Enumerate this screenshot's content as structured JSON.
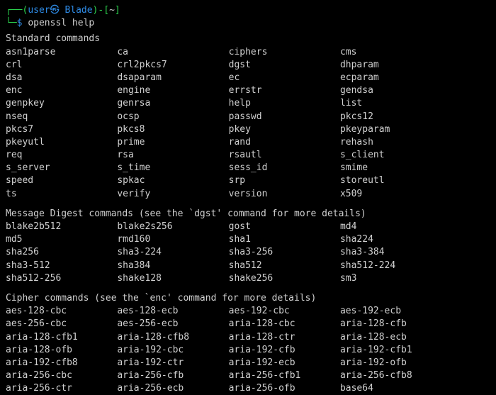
{
  "prompt": {
    "open_paren": "┌──(",
    "user": "user㉿ Blade",
    "close_paren": ")-[",
    "cwd": "~",
    "close_bracket": "]",
    "line2_prefix": "└─",
    "dollar": "$",
    "command": "openssl help"
  },
  "sections": {
    "standard": {
      "heading": "Standard commands",
      "rows": [
        [
          "asn1parse",
          "ca",
          "ciphers",
          "cms"
        ],
        [
          "crl",
          "crl2pkcs7",
          "dgst",
          "dhparam"
        ],
        [
          "dsa",
          "dsaparam",
          "ec",
          "ecparam"
        ],
        [
          "enc",
          "engine",
          "errstr",
          "gendsa"
        ],
        [
          "genpkey",
          "genrsa",
          "help",
          "list"
        ],
        [
          "nseq",
          "ocsp",
          "passwd",
          "pkcs12"
        ],
        [
          "pkcs7",
          "pkcs8",
          "pkey",
          "pkeyparam"
        ],
        [
          "pkeyutl",
          "prime",
          "rand",
          "rehash"
        ],
        [
          "req",
          "rsa",
          "rsautl",
          "s_client"
        ],
        [
          "s_server",
          "s_time",
          "sess_id",
          "smime"
        ],
        [
          "speed",
          "spkac",
          "srp",
          "storeutl"
        ],
        [
          "ts",
          "verify",
          "version",
          "x509"
        ]
      ]
    },
    "digest": {
      "heading": "Message Digest commands (see the `dgst' command for more details)",
      "rows": [
        [
          "blake2b512",
          "blake2s256",
          "gost",
          "md4"
        ],
        [
          "md5",
          "rmd160",
          "sha1",
          "sha224"
        ],
        [
          "sha256",
          "sha3-224",
          "sha3-256",
          "sha3-384"
        ],
        [
          "sha3-512",
          "sha384",
          "sha512",
          "sha512-224"
        ],
        [
          "sha512-256",
          "shake128",
          "shake256",
          "sm3"
        ]
      ]
    },
    "cipher": {
      "heading": "Cipher commands (see the `enc' command for more details)",
      "rows": [
        [
          "aes-128-cbc",
          "aes-128-ecb",
          "aes-192-cbc",
          "aes-192-ecb"
        ],
        [
          "aes-256-cbc",
          "aes-256-ecb",
          "aria-128-cbc",
          "aria-128-cfb"
        ],
        [
          "aria-128-cfb1",
          "aria-128-cfb8",
          "aria-128-ctr",
          "aria-128-ecb"
        ],
        [
          "aria-128-ofb",
          "aria-192-cbc",
          "aria-192-cfb",
          "aria-192-cfb1"
        ],
        [
          "aria-192-cfb8",
          "aria-192-ctr",
          "aria-192-ecb",
          "aria-192-ofb"
        ],
        [
          "aria-256-cbc",
          "aria-256-cfb",
          "aria-256-cfb1",
          "aria-256-cfb8"
        ],
        [
          "aria-256-ctr",
          "aria-256-ecb",
          "aria-256-ofb",
          "base64"
        ]
      ]
    }
  }
}
